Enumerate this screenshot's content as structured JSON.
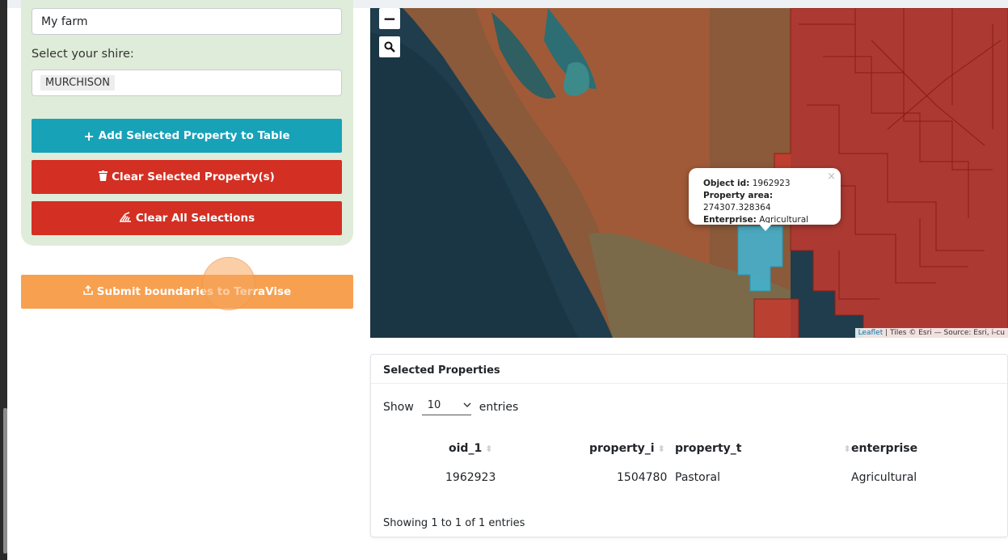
{
  "form": {
    "farm_name_value": "My farm",
    "shire_label": "Select your shire:",
    "shire_value": "MURCHISON"
  },
  "buttons": {
    "add": "Add Selected Property to Table",
    "clear_selected": "Clear Selected Property(s)",
    "clear_all": "Clear All Selections",
    "submit": "Submit boundaries to TerraVise"
  },
  "map": {
    "zoom_out": "−",
    "popup": {
      "object_id_label": "Object id:",
      "object_id": "1962923",
      "area_label": "Property area:",
      "area": "274307.328364",
      "enterprise_label": "Enterprise:",
      "enterprise": "Agricultural"
    },
    "attribution_link": "Leaflet",
    "attribution_text": "| Tiles © Esri — Source: Esri, i-cu"
  },
  "table": {
    "title": "Selected Properties",
    "show_label": "Show",
    "length_value": "10",
    "entries_label": "entries",
    "columns": [
      "oid_1",
      "property_i",
      "property_t",
      "enterprise"
    ],
    "rows": [
      [
        "1962923",
        "1504780",
        "Pastoral",
        "Agricultural"
      ]
    ],
    "info": "Showing 1 to 1 of 1 entries"
  },
  "colors": {
    "teal": "#17a2b8",
    "red": "#d42f23",
    "orange": "#f7a050",
    "panel": "#dfecd9",
    "selected_parcel": "#3fb6d6",
    "parcels": "#c53a2e"
  }
}
